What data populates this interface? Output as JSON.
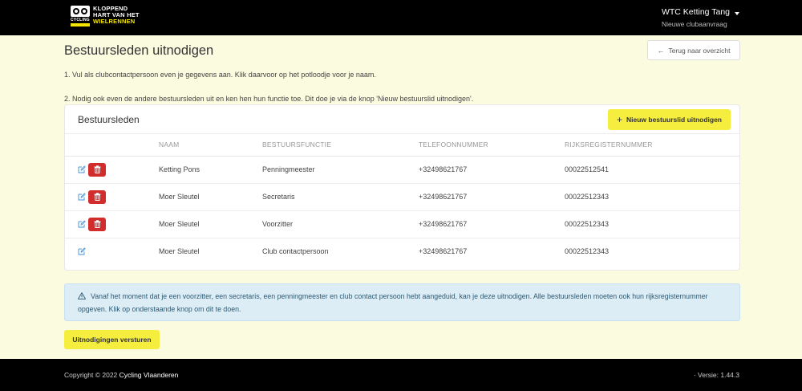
{
  "header": {
    "logo": {
      "lines": [
        "KLOPPEND",
        "HART VAN HET",
        "WIELRENNEN"
      ],
      "mark_text": "CYCLING"
    },
    "account": {
      "name": "WTC Ketting Tang",
      "subtitle": "Nieuwe clubaanvraag"
    }
  },
  "page": {
    "title": "Bestuursleden uitnodigen",
    "back_button": "Terug naar overzicht",
    "step1": "1. Vul als clubcontactpersoon even je gegevens aan. Klik daarvoor op het potloodje voor je naam.",
    "step2": "2. Nodig ook even de andere bestuursleden uit en ken hen hun functie toe. Dit doe je via de knop 'Nieuw bestuurslid uitnodigen'."
  },
  "card": {
    "title": "Bestuursleden",
    "new_button": "Nieuw bestuurslid uitnodigen",
    "columns": [
      "NAAM",
      "BESTUURSFUNCTIE",
      "TELEFOONNUMMER",
      "RIJKSREGISTERNUMMER"
    ],
    "rows": [
      {
        "naam": "Ketting Pons",
        "functie": "Penningmeester",
        "telefoon": "+32498621767",
        "rijksregister": "00022512541",
        "deletable": true
      },
      {
        "naam": "Moer Sleutel",
        "functie": "Secretaris",
        "telefoon": "+32498621767",
        "rijksregister": "00022512343",
        "deletable": true
      },
      {
        "naam": "Moer Sleutel",
        "functie": "Voorzitter",
        "telefoon": "+32498621767",
        "rijksregister": "00022512343",
        "deletable": true
      },
      {
        "naam": "Moer Sleutel",
        "functie": "Club contactpersoon",
        "telefoon": "+32498621767",
        "rijksregister": "00022512343",
        "deletable": false
      }
    ]
  },
  "alert": {
    "text": "Vanaf het moment dat je een voorzitter, een secretaris, een penningmeester en club contact persoon hebt aangeduid, kan je deze uitnodigen. Alle bestuursleden moeten ook hun rijksregisternummer opgeven. Klik op onderstaande knop om dit te doen."
  },
  "send_button": "Uitnodigingen versturen",
  "footer": {
    "copyright": "Copyright © 2022",
    "brand": "Cycling Vlaanderen",
    "version": "· Versie: 1.44.3"
  },
  "colors": {
    "accent_yellow": "#f5ee3f",
    "danger": "#d12d2d",
    "page_bg": "#fbfbe0",
    "edit_icon": "#3d8fd6"
  }
}
